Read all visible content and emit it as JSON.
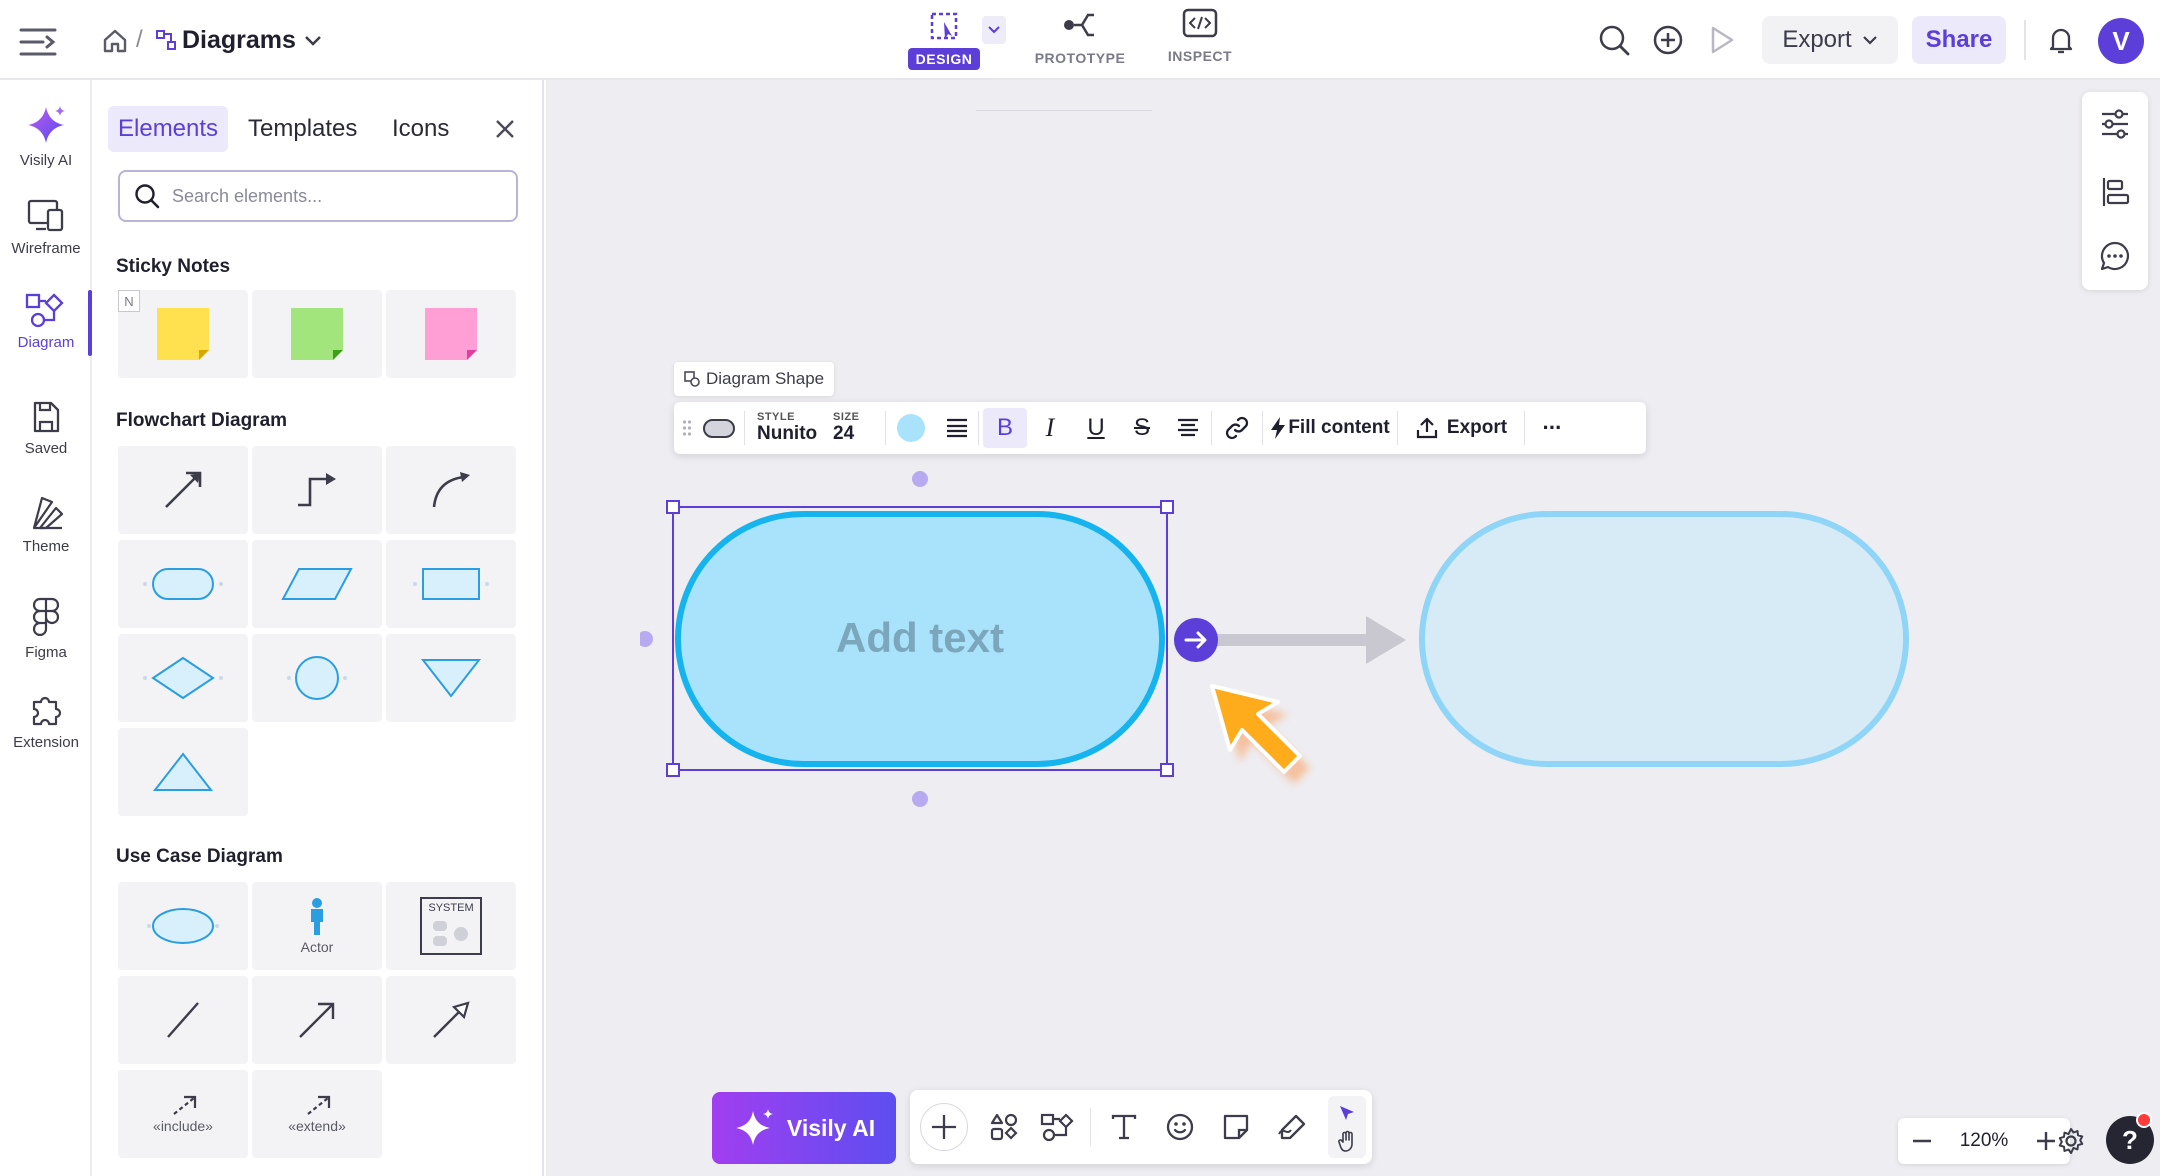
{
  "header": {
    "breadcrumb_title": "Diagrams",
    "modes": [
      {
        "label": "DESIGN",
        "active": true
      },
      {
        "label": "PROTOTYPE",
        "active": false
      },
      {
        "label": "INSPECT",
        "active": false
      }
    ],
    "export_label": "Export",
    "share_label": "Share",
    "avatar_letter": "V"
  },
  "rail": {
    "items": [
      {
        "label": "Visily AI",
        "icon": "sparkle-icon"
      },
      {
        "label": "Wireframe",
        "icon": "wireframe-icon"
      },
      {
        "label": "Diagram",
        "icon": "diagram-icon",
        "active": true
      },
      {
        "label": "Saved",
        "icon": "saved-icon"
      },
      {
        "label": "Theme",
        "icon": "theme-icon"
      },
      {
        "label": "Figma",
        "icon": "figma-icon"
      },
      {
        "label": "Extension",
        "icon": "puzzle-icon"
      }
    ]
  },
  "panel": {
    "tabs": [
      "Elements",
      "Templates",
      "Icons"
    ],
    "active_tab": "Elements",
    "search_placeholder": "Search elements...",
    "sections": {
      "sticky": "Sticky Notes",
      "flowchart": "Flowchart Diagram",
      "usecase": "Use Case Diagram"
    },
    "sticky_badge": "N",
    "sticky_colors": [
      "#ffe14f",
      "#a3e57d",
      "#ff9fd6"
    ],
    "usecase_captions": {
      "actor": "Actor",
      "system": "SYSTEM",
      "include": "«include»",
      "extend": "«extend»"
    }
  },
  "canvas": {
    "shape_tag": "Diagram Shape",
    "toolbar": {
      "style_label": "STYLE",
      "style_value": "Nunito",
      "size_label": "SIZE",
      "size_value": "24",
      "bold": "B",
      "italic": "I",
      "underline": "U",
      "strike": "S",
      "fill_content": "Fill content",
      "export": "Export",
      "more": "···"
    },
    "shape_text": "Add text",
    "accent": "#5b3fd8",
    "shape_fill": "#a8e2fb",
    "shape_stroke": "#16b4ef"
  },
  "bottom_bar": {
    "ai_label": "Visily AI"
  },
  "zoom": {
    "value": "120%"
  },
  "help_label": "?"
}
